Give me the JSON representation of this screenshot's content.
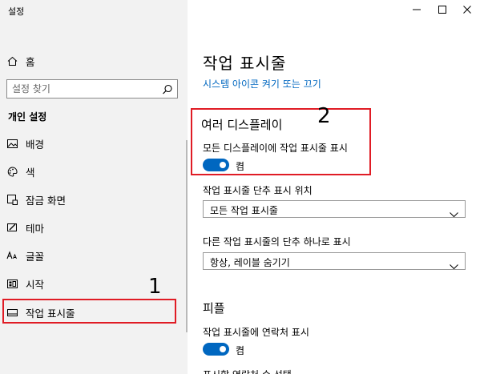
{
  "window": {
    "title": "설정",
    "controls": [
      "minimize-icon",
      "maximize-icon",
      "close-icon"
    ]
  },
  "sidebar": {
    "home_label": "홈",
    "search_placeholder": "설정 찾기",
    "section_heading": "개인 설정",
    "items": [
      {
        "label": "배경",
        "icon": "picture-icon"
      },
      {
        "label": "색",
        "icon": "palette-icon"
      },
      {
        "label": "잠금 화면",
        "icon": "lock-screen-icon"
      },
      {
        "label": "테마",
        "icon": "theme-icon"
      },
      {
        "label": "글꼴",
        "icon": "font-icon"
      },
      {
        "label": "시작",
        "icon": "start-icon"
      },
      {
        "label": "작업 표시줄",
        "icon": "taskbar-icon",
        "selected": true
      }
    ]
  },
  "main": {
    "title": "작업 표시줄",
    "link": "시스템 아이콘 켜기 또는 끄기",
    "multi_display": {
      "heading": "여러 디스플레이",
      "show_all_label": "모든 디스플레이에 작업 표시줄 표시",
      "show_all_state": "켬",
      "buttons_label": "작업 표시줄 단추 표시 위치",
      "buttons_value": "모든 작업 표시줄",
      "combine_label": "다른 작업 표시줄의 단추 하나로 표시",
      "combine_value": "항상, 레이블 숨기기"
    },
    "people": {
      "heading": "피플",
      "contacts_label": "작업 표시줄에 연락처 표시",
      "contacts_state": "켬",
      "choose_label": "표시할 연락처 수 선택"
    }
  },
  "annotations": {
    "one": "1",
    "two": "2"
  },
  "colors": {
    "accent": "#0067c0",
    "annotation_red": "#e01c25",
    "sidebar_bg": "#f2f2f2"
  }
}
